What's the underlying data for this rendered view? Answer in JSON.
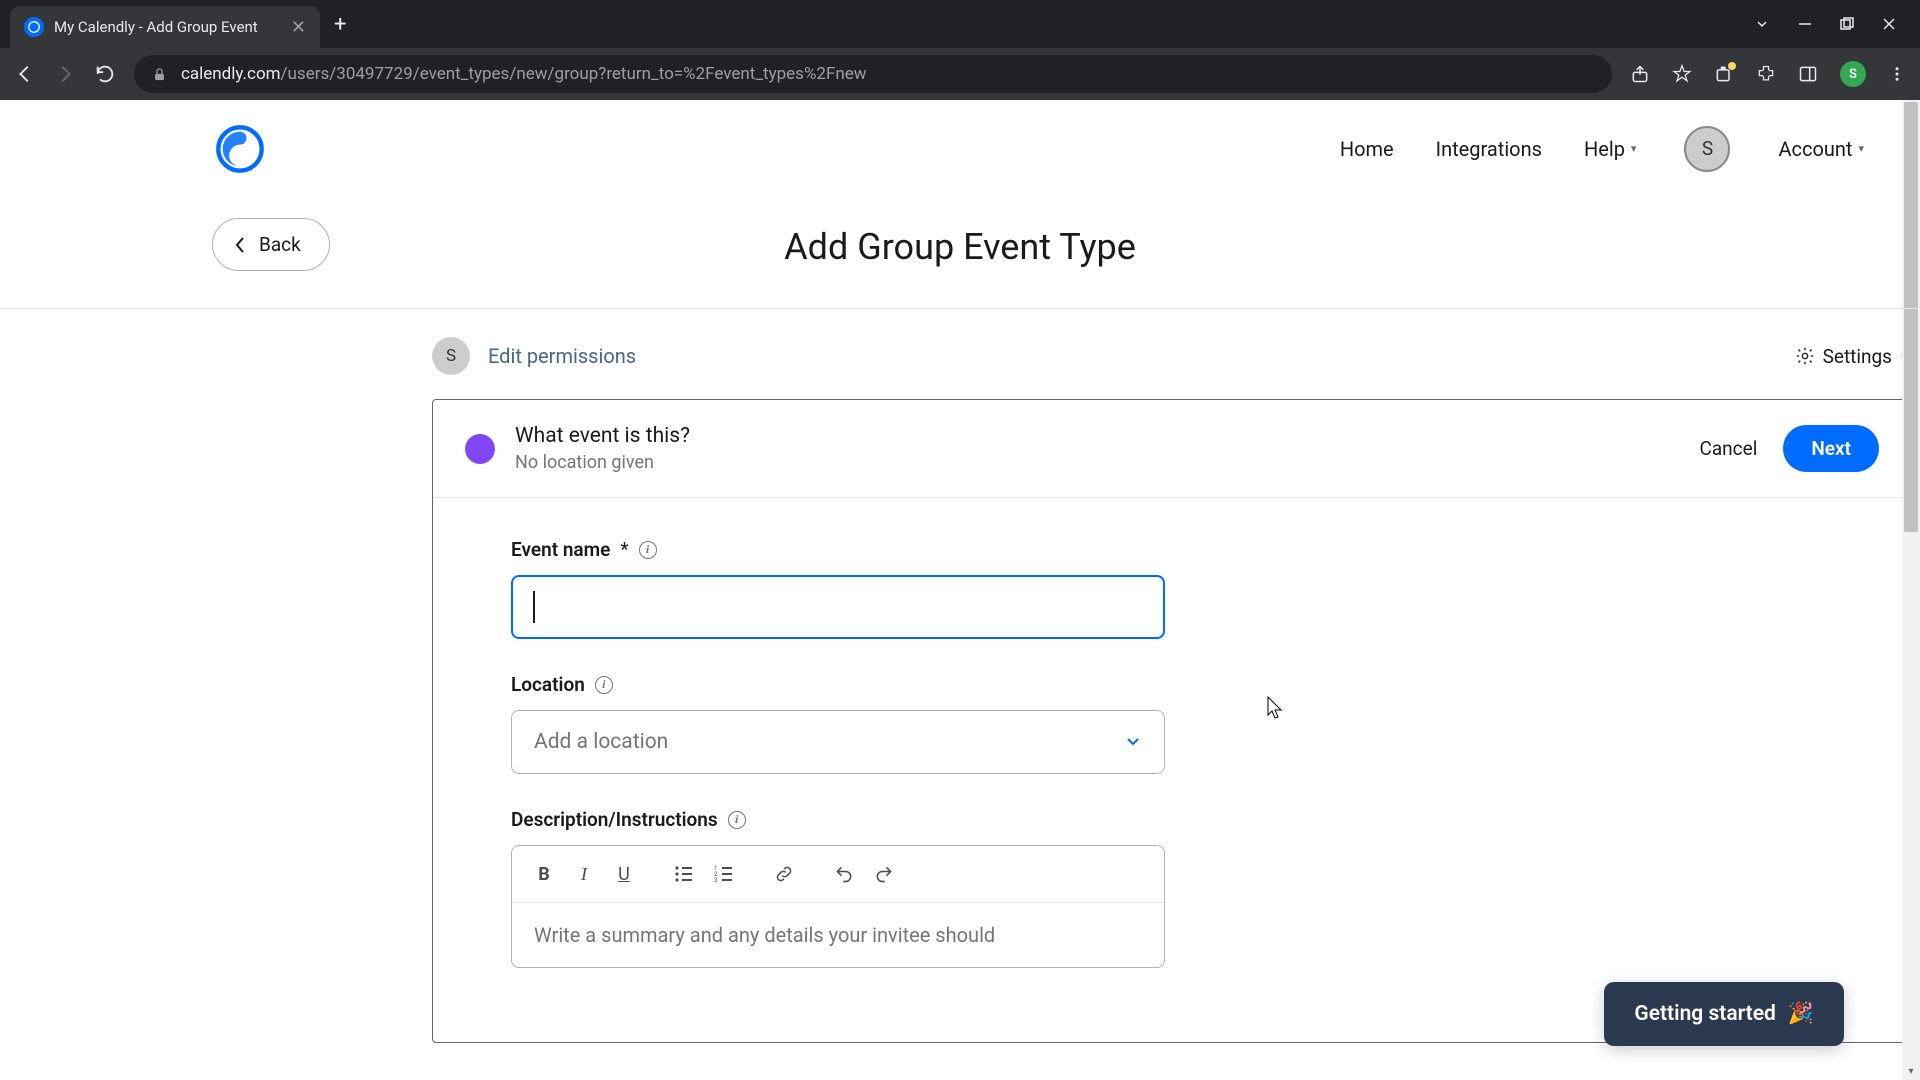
{
  "browser": {
    "tab_title": "My Calendly - Add Group Event",
    "url_host": "calendly.com",
    "url_path": "/users/30497729/event_types/new/group?return_to=%2Fevent_types%2Fnew",
    "profile_initial": "S"
  },
  "header": {
    "nav": {
      "home": "Home",
      "integrations": "Integrations",
      "help": "Help",
      "account": "Account"
    },
    "avatar_initial": "S"
  },
  "page": {
    "back_label": "Back",
    "title": "Add Group Event Type"
  },
  "permissions": {
    "avatar_initial": "S",
    "edit_label": "Edit permissions",
    "settings_label": "Settings"
  },
  "card": {
    "title": "What event is this?",
    "subtitle": "No location given",
    "cancel_label": "Cancel",
    "next_label": "Next",
    "accent_color": "#8247f5"
  },
  "form": {
    "event_name": {
      "label": "Event name",
      "required_mark": "*",
      "value": ""
    },
    "location": {
      "label": "Location",
      "placeholder": "Add a location"
    },
    "description": {
      "label": "Description/Instructions",
      "placeholder": "Write a summary and any details your invitee should"
    }
  },
  "widget": {
    "getting_started": "Getting started"
  }
}
